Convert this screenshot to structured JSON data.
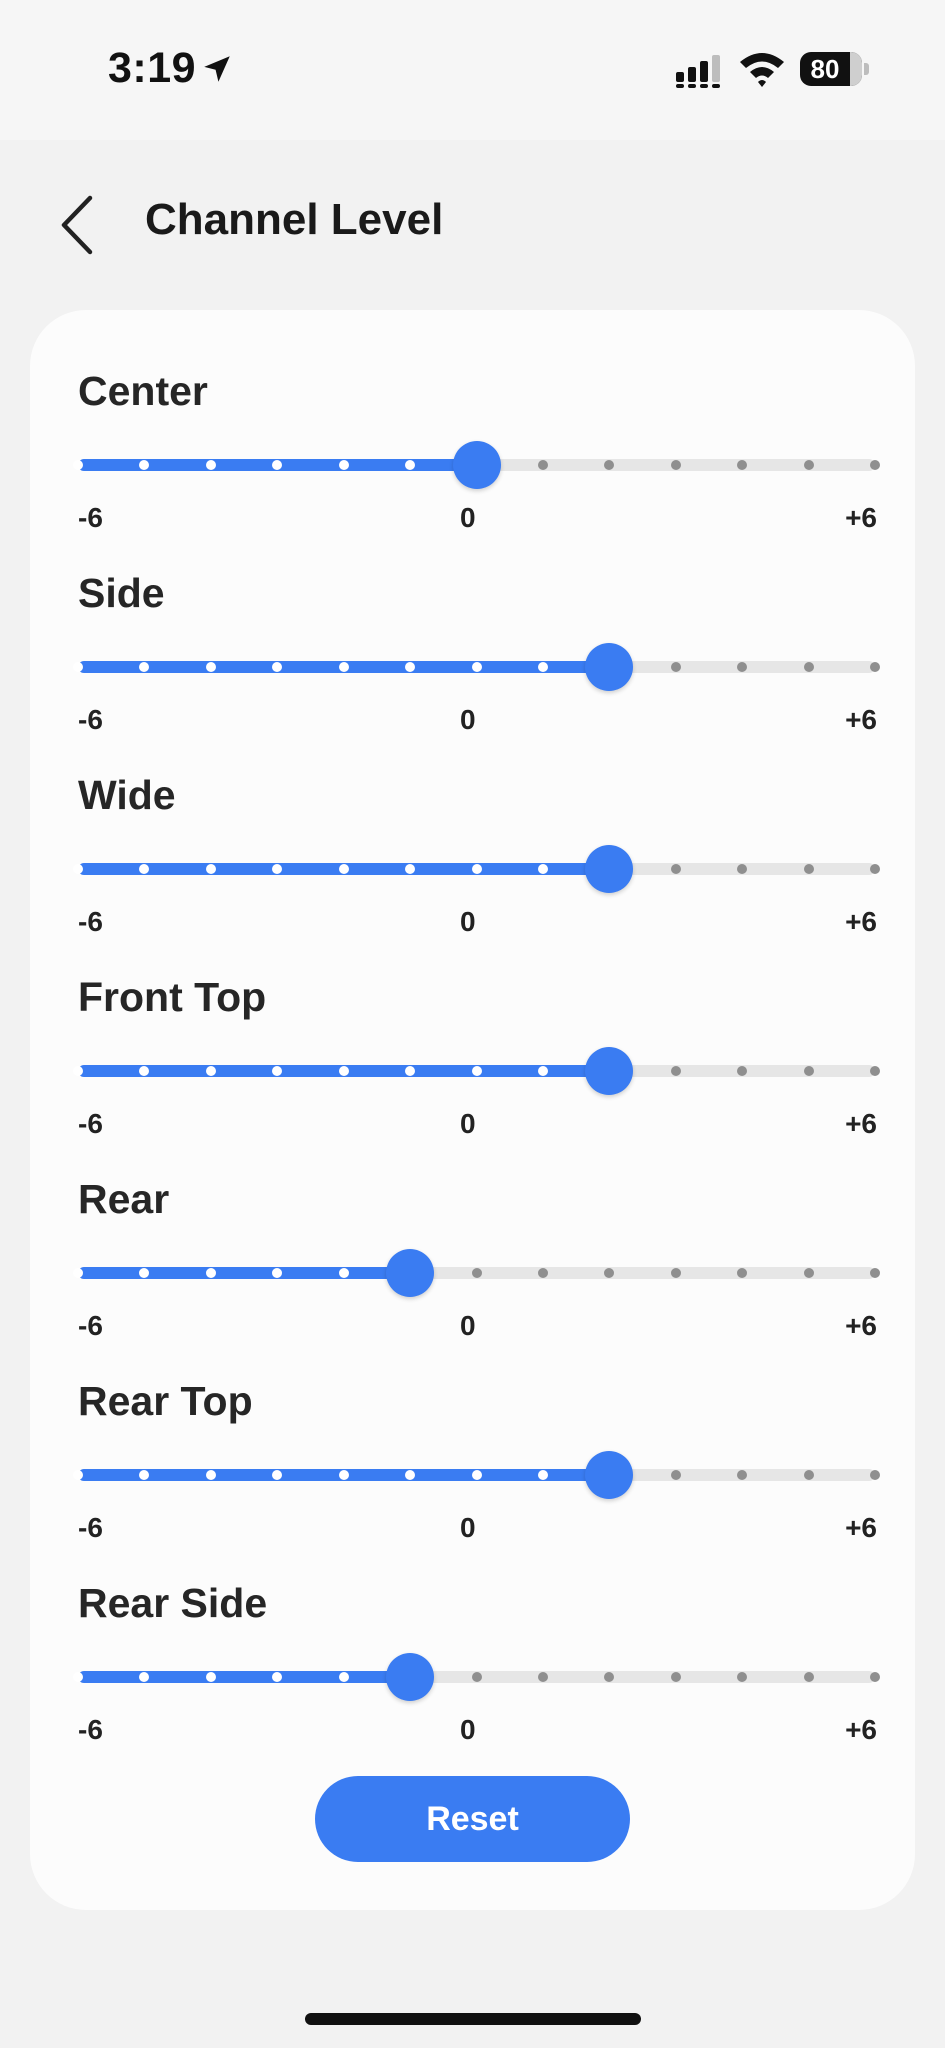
{
  "status_bar": {
    "time": "3:19",
    "battery": "80",
    "icons": [
      "location-arrow-icon",
      "cellular-signal-icon",
      "wifi-icon",
      "battery-icon"
    ]
  },
  "header": {
    "title": "Channel Level",
    "back_icon": "chevron-left-icon"
  },
  "scale": {
    "min": "-6",
    "mid": "0",
    "max": "+6"
  },
  "channels": [
    {
      "label": "Center",
      "value": 0
    },
    {
      "label": "Side",
      "value": 2
    },
    {
      "label": "Wide",
      "value": 2
    },
    {
      "label": "Front Top",
      "value": 2
    },
    {
      "label": "Rear",
      "value": -1
    },
    {
      "label": "Rear Top",
      "value": 2
    },
    {
      "label": "Rear Side",
      "value": -1
    }
  ],
  "reset_label": "Reset",
  "colors": {
    "accent": "#3a7cf2",
    "track": "#e6e6e6",
    "tick_inactive": "#8f8f8f",
    "card": "#fcfcfc",
    "background": "#f2f2f2"
  }
}
